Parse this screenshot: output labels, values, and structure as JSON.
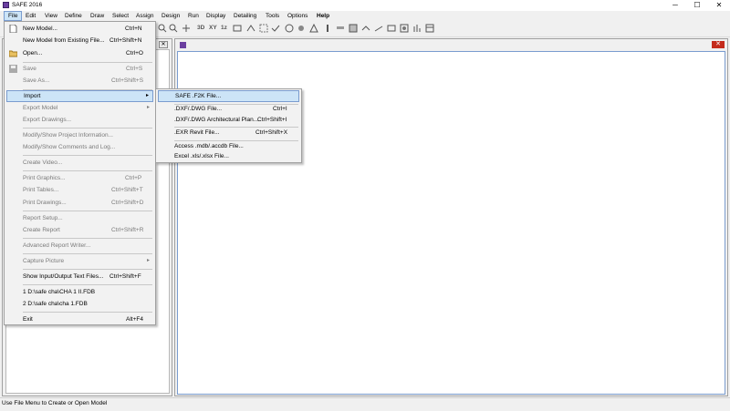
{
  "window": {
    "title": "SAFE 2016",
    "minimize": "─",
    "maximize": "☐",
    "close": "✕"
  },
  "menubar": [
    "File",
    "Edit",
    "View",
    "Define",
    "Draw",
    "Select",
    "Assign",
    "Design",
    "Run",
    "Display",
    "Detailing",
    "Tools",
    "Options",
    "Help"
  ],
  "toolbar": {
    "text_3d": "3D",
    "text_xy": "XY",
    "text_1z": "1z"
  },
  "file_menu": [
    {
      "label": "New Model...",
      "shortcut": "Ctrl+N",
      "disabled": false
    },
    {
      "label": "New Model from Existing File...",
      "shortcut": "Ctrl+Shift+N",
      "disabled": false
    },
    {
      "label": "Open...",
      "shortcut": "Ctrl+O",
      "disabled": false
    },
    {
      "label": "Save",
      "shortcut": "Ctrl+S",
      "disabled": true
    },
    {
      "label": "Save As...",
      "shortcut": "Ctrl+Shift+S",
      "disabled": true
    },
    {
      "label": "Import",
      "shortcut": "",
      "disabled": false
    },
    {
      "label": "Export Model",
      "shortcut": "",
      "disabled": true
    },
    {
      "label": "Export Drawings...",
      "shortcut": "",
      "disabled": true
    },
    {
      "label": "Modify/Show Project Information...",
      "shortcut": "",
      "disabled": true
    },
    {
      "label": "Modify/Show Comments and Log...",
      "shortcut": "",
      "disabled": true
    },
    {
      "label": "Create Video...",
      "shortcut": "",
      "disabled": true
    },
    {
      "label": "Print Graphics...",
      "shortcut": "Ctrl+P",
      "disabled": true
    },
    {
      "label": "Print Tables...",
      "shortcut": "Ctrl+Shift+T",
      "disabled": true
    },
    {
      "label": "Print Drawings...",
      "shortcut": "Ctrl+Shift+D",
      "disabled": true
    },
    {
      "label": "Report Setup...",
      "shortcut": "",
      "disabled": true
    },
    {
      "label": "Create Report",
      "shortcut": "Ctrl+Shift+R",
      "disabled": true
    },
    {
      "label": "Advanced Report Writer...",
      "shortcut": "",
      "disabled": true
    },
    {
      "label": "Capture Picture",
      "shortcut": "",
      "disabled": true
    },
    {
      "label": "Show Input/Output Text Files...",
      "shortcut": "Ctrl+Shift+F",
      "disabled": false
    },
    {
      "label": "1 D:\\safe cha\\CHA 1 II.FDB",
      "shortcut": "",
      "disabled": false
    },
    {
      "label": "2 D:\\safe cha\\cha 1.FDB",
      "shortcut": "",
      "disabled": false
    },
    {
      "label": "Exit",
      "shortcut": "Alt+F4",
      "disabled": false
    }
  ],
  "import_menu": [
    {
      "label": "SAFE .F2K File...",
      "shortcut": ""
    },
    {
      "label": ".DXF/.DWG File...",
      "shortcut": "Ctrl+I"
    },
    {
      "label": ".DXF/.DWG Architectural Plan...",
      "shortcut": "Ctrl+Shift+I"
    },
    {
      "label": ".EXR Revit File...",
      "shortcut": "Ctrl+Shift+X"
    },
    {
      "label": "Access .mdb/.accdb File...",
      "shortcut": ""
    },
    {
      "label": "Excel .xls/.xlsx File...",
      "shortcut": ""
    }
  ],
  "left_pane": {
    "close": "✕"
  },
  "right_pane": {
    "close": "✕"
  },
  "status": "Use File Menu to Create or Open Model",
  "colors": {
    "accent": "#cce4f7",
    "accent_border": "#7a9ccf",
    "app_icon": "#6b3fa0"
  }
}
